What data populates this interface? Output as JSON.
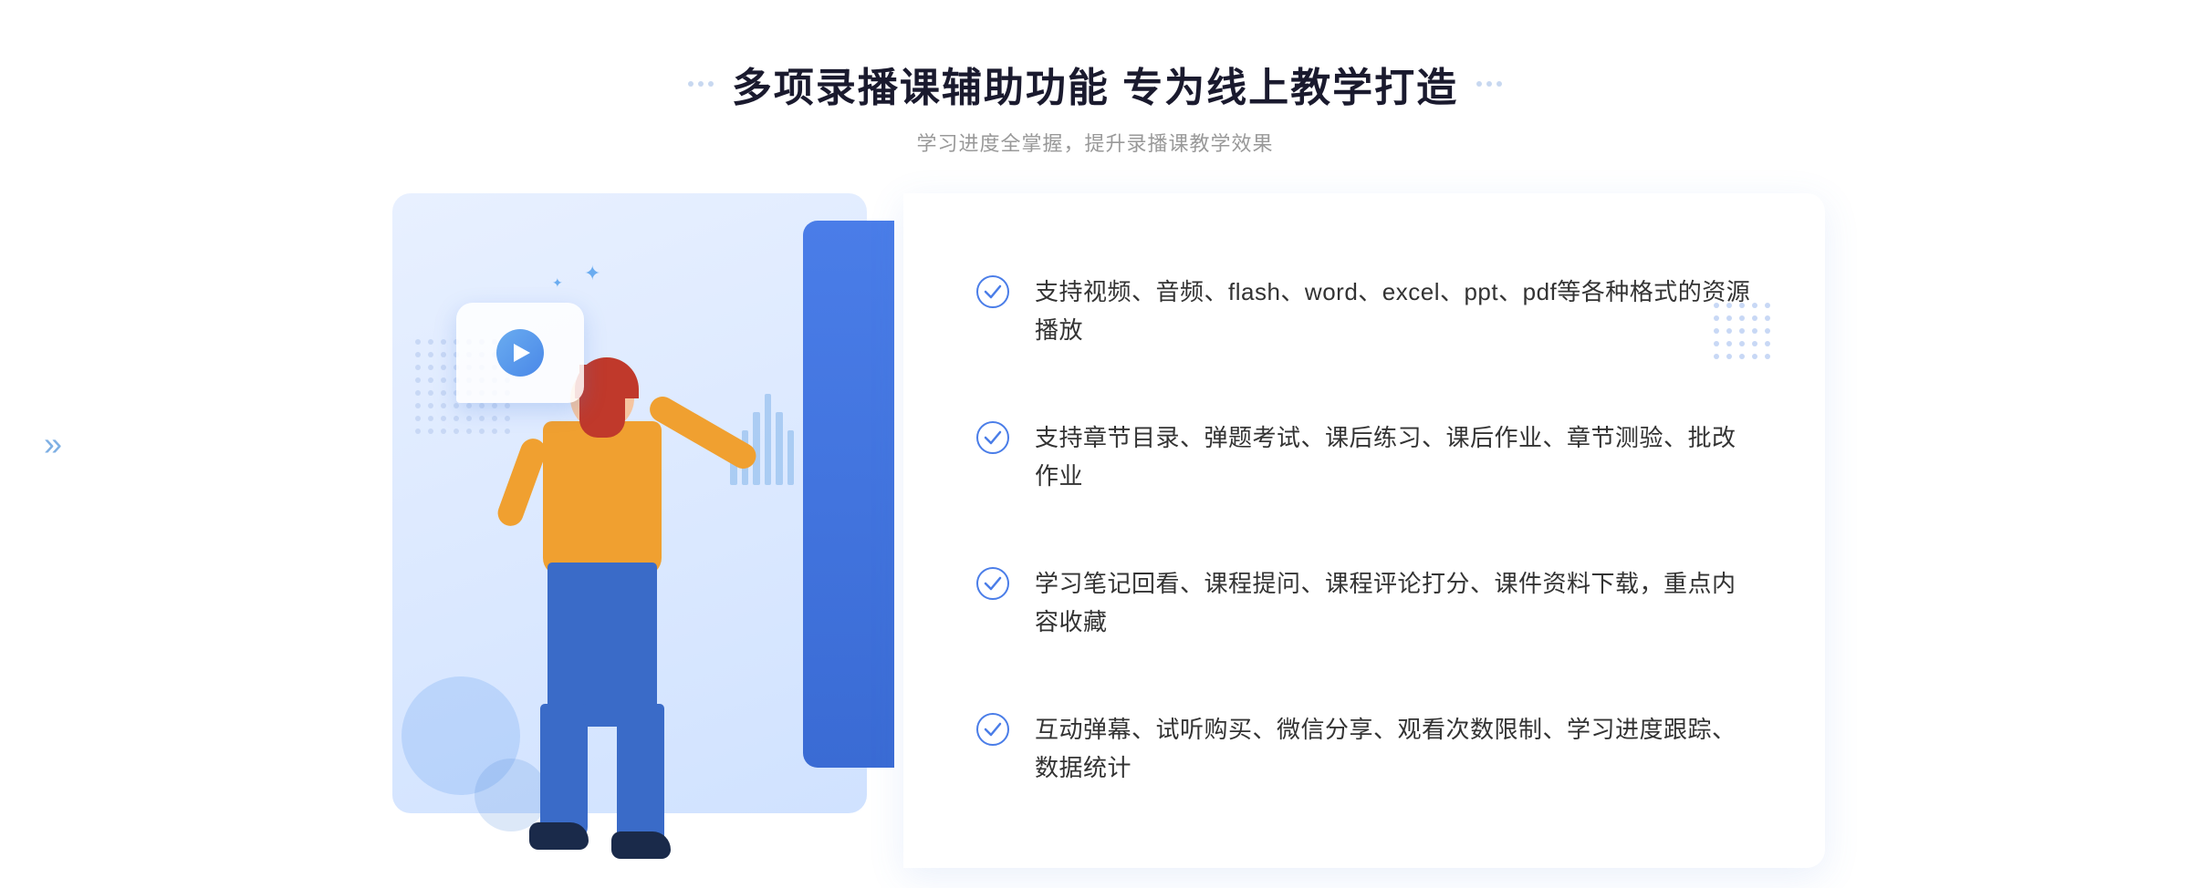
{
  "header": {
    "title": "多项录播课辅助功能 专为线上教学打造",
    "subtitle": "学习进度全掌握，提升录播课教学效果",
    "deco_dots_count": 3
  },
  "features": [
    {
      "id": 1,
      "text": "支持视频、音频、flash、word、excel、ppt、pdf等各种格式的资源播放"
    },
    {
      "id": 2,
      "text": "支持章节目录、弹题考试、课后练习、课后作业、章节测验、批改作业"
    },
    {
      "id": 3,
      "text": "学习笔记回看、课程提问、课程评论打分、课件资料下载，重点内容收藏"
    },
    {
      "id": 4,
      "text": "互动弹幕、试听购买、微信分享、观看次数限制、学习进度跟踪、数据统计"
    }
  ],
  "colors": {
    "primary": "#4a7de8",
    "accent": "#f0a030",
    "text_dark": "#1a1a2e",
    "text_mid": "#333333",
    "text_light": "#999999",
    "check_color": "#4a7de8",
    "dot_color": "#c8d8f5"
  },
  "decorations": {
    "chevron": "»",
    "sparkle": "✦"
  }
}
